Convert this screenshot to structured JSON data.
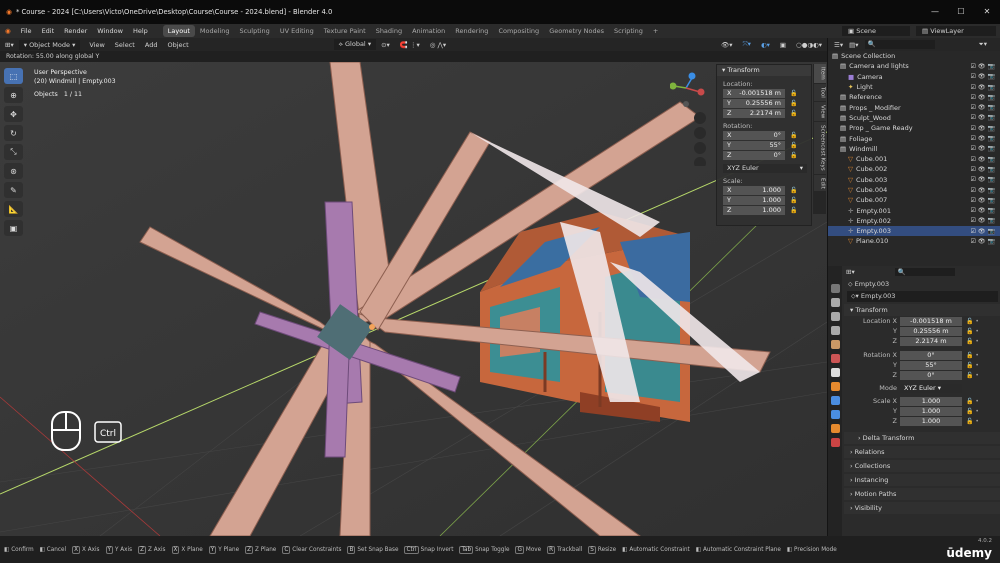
{
  "title_bar": {
    "text": "* Course - 2024 [C:\\Users\\Victo\\OneDrive\\Desktop\\Course\\Course - 2024.blend] - Blender 4.0"
  },
  "menu": {
    "items": [
      "File",
      "Edit",
      "Render",
      "Window",
      "Help"
    ],
    "workspaces": [
      "Layout",
      "Modeling",
      "Sculpting",
      "UV Editing",
      "Texture Paint",
      "Shading",
      "Animation",
      "Rendering",
      "Compositing",
      "Geometry Nodes",
      "Scripting",
      "+"
    ],
    "scene": "Scene",
    "view_layer": "ViewLayer"
  },
  "viewport_header": {
    "mode": "Object Mode",
    "items": [
      "View",
      "Select",
      "Add",
      "Object"
    ],
    "orientation": "Global"
  },
  "status_line": "Rotation: 55.00 along global Y",
  "viewport_info": {
    "line1": "User Perspective",
    "line2": "(20) Windmill | Empty.003",
    "objects_label": "Objects",
    "objects_count": "1 / 11"
  },
  "key_overlay": {
    "ctrl": "Ctrl"
  },
  "n_panel": {
    "title": "Transform",
    "location_label": "Location:",
    "location": {
      "x": "-0.001518 m",
      "y": "0.25556 m",
      "z": "2.2174 m"
    },
    "rotation_label": "Rotation:",
    "rotation": {
      "x": "0°",
      "y": "55°",
      "z": "0°"
    },
    "rotation_mode": "XYZ Euler",
    "scale_label": "Scale:",
    "scale": {
      "x": "1.000",
      "y": "1.000",
      "z": "1.000"
    },
    "tabs": [
      "Item",
      "Tool",
      "View",
      "Screencast Keys",
      "Edit"
    ]
  },
  "outliner": {
    "items": [
      {
        "name": "Scene Collection",
        "depth": 0,
        "type": "collection",
        "selected": false
      },
      {
        "name": "Camera and lights",
        "depth": 1,
        "type": "collection",
        "selected": false
      },
      {
        "name": "Camera",
        "depth": 2,
        "type": "camera",
        "selected": false
      },
      {
        "name": "Light",
        "depth": 2,
        "type": "light",
        "selected": false
      },
      {
        "name": "Reference",
        "depth": 1,
        "type": "collection",
        "selected": false
      },
      {
        "name": "Props _ Modifier",
        "depth": 1,
        "type": "collection",
        "selected": false
      },
      {
        "name": "Sculpt_Wood",
        "depth": 1,
        "type": "collection",
        "selected": false
      },
      {
        "name": "Prop _ Game Ready",
        "depth": 1,
        "type": "collection",
        "selected": false
      },
      {
        "name": "Foliage",
        "depth": 1,
        "type": "collection",
        "selected": false
      },
      {
        "name": "Windmill",
        "depth": 1,
        "type": "collection",
        "selected": false
      },
      {
        "name": "Cube.001",
        "depth": 2,
        "type": "mesh",
        "selected": false
      },
      {
        "name": "Cube.002",
        "depth": 2,
        "type": "mesh",
        "selected": false
      },
      {
        "name": "Cube.003",
        "depth": 2,
        "type": "mesh",
        "selected": false
      },
      {
        "name": "Cube.004",
        "depth": 2,
        "type": "mesh",
        "selected": false
      },
      {
        "name": "Cube.007",
        "depth": 2,
        "type": "mesh",
        "selected": false
      },
      {
        "name": "Empty.001",
        "depth": 2,
        "type": "empty",
        "selected": false
      },
      {
        "name": "Empty.002",
        "depth": 2,
        "type": "empty",
        "selected": false
      },
      {
        "name": "Empty.003",
        "depth": 2,
        "type": "empty",
        "selected": true
      },
      {
        "name": "Plane.010",
        "depth": 2,
        "type": "mesh",
        "selected": false
      }
    ]
  },
  "properties": {
    "object_name": "Empty.003",
    "object_field": "Empty.003",
    "transform_label": "Transform",
    "location_x_label": "Location X",
    "location": {
      "x": "-0.001518 m",
      "y": "0.25556 m",
      "z": "2.2174 m"
    },
    "rotation_x_label": "Rotation X",
    "rotation": {
      "x": "0°",
      "y": "55°",
      "z": "0°"
    },
    "mode_label": "Mode",
    "mode": "XYZ Euler",
    "scale_x_label": "Scale X",
    "scale": {
      "x": "1.000",
      "y": "1.000",
      "z": "1.000"
    },
    "y_label": "Y",
    "z_label": "Z",
    "sections": [
      "Delta Transform",
      "Relations",
      "Collections",
      "Instancing",
      "Motion Paths",
      "Visibility"
    ]
  },
  "status_bar": {
    "items": [
      {
        "key": "",
        "label": "Confirm"
      },
      {
        "key": "",
        "label": "Cancel"
      },
      {
        "key": "X",
        "label": "X Axis"
      },
      {
        "key": "Y",
        "label": "Y Axis"
      },
      {
        "key": "Z",
        "label": "Z Axis"
      },
      {
        "key": "X",
        "label": "X Plane"
      },
      {
        "key": "Y",
        "label": "Y Plane"
      },
      {
        "key": "Z",
        "label": "Z Plane"
      },
      {
        "key": "C",
        "label": "Clear Constraints"
      },
      {
        "key": "B",
        "label": "Set Snap Base"
      },
      {
        "key": "Ctrl",
        "label": "Snap Invert"
      },
      {
        "key": "Tab",
        "label": "Snap Toggle"
      },
      {
        "key": "G",
        "label": "Move"
      },
      {
        "key": "R",
        "label": "Trackball"
      },
      {
        "key": "S",
        "label": "Resize"
      },
      {
        "key": "",
        "label": "Automatic Constraint"
      },
      {
        "key": "",
        "label": "Automatic Constraint Plane"
      },
      {
        "key": "",
        "label": "Precision Mode"
      }
    ],
    "version": "4.0.2",
    "brand": "ūdemy"
  }
}
